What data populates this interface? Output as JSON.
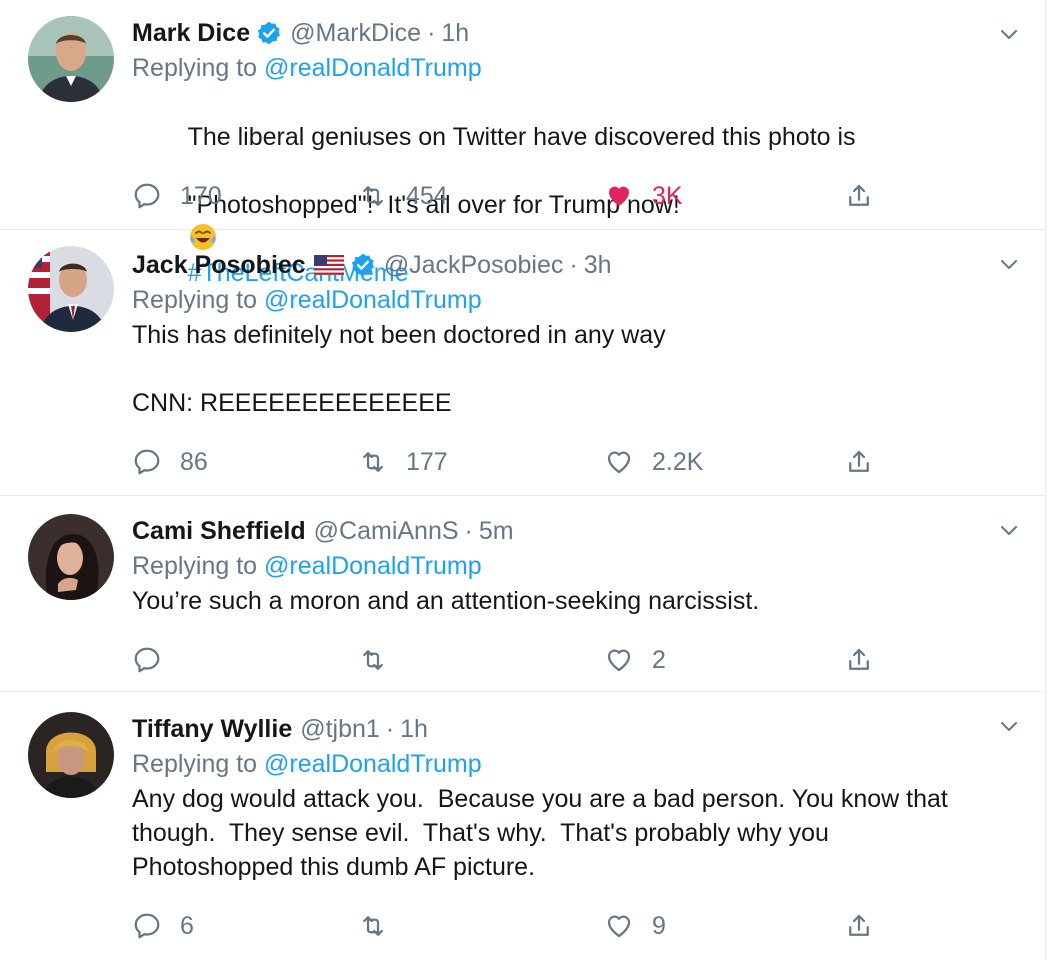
{
  "colors": {
    "link": "#1da1f2",
    "muted": "#657786",
    "like": "#e0245e",
    "text": "#14171a"
  },
  "replying_prefix": "Replying to",
  "tweets": [
    {
      "name": "Mark Dice",
      "verified": true,
      "handle": "@MarkDice",
      "time": "1h",
      "reply_to": "@realDonaldTrump",
      "text_line1": "The liberal geniuses on Twitter have discovered this photo is",
      "text_line2": "\"Photoshopped\"!  It's all over for Trump now!",
      "hashtag": "#TheLeftCantMeme",
      "emoji": "tears-of-joy-emoji",
      "replies": "170",
      "retweets": "454",
      "likes": "3K",
      "liked": true
    },
    {
      "name": "Jack Posobiec",
      "flag": "us-flag",
      "verified": true,
      "handle": "@JackPosobiec",
      "time": "3h",
      "reply_to": "@realDonaldTrump",
      "text": "This has definitely not been doctored in any way\n\nCNN: REEEEEEEEEEEEEE",
      "replies": "86",
      "retweets": "177",
      "likes": "2.2K",
      "liked": false
    },
    {
      "name": "Cami Sheffield",
      "verified": false,
      "handle": "@CamiAnnS",
      "time": "5m",
      "reply_to": "@realDonaldTrump",
      "text": "You’re such a moron and an attention-seeking narcissist.",
      "replies": "",
      "retweets": "",
      "likes": "2",
      "liked": false
    },
    {
      "name": "Tiffany Wyllie",
      "verified": false,
      "handle": "@tjbn1",
      "time": "1h",
      "reply_to": "@realDonaldTrump",
      "text": "Any dog would attack you.  Because you are a bad person. You know that\nthough.  They sense evil.  That's why.  That's probably why you\nPhotoshopped this dumb AF picture.",
      "replies": "6",
      "retweets": "",
      "likes": "9",
      "liked": false
    }
  ],
  "separator": "·"
}
